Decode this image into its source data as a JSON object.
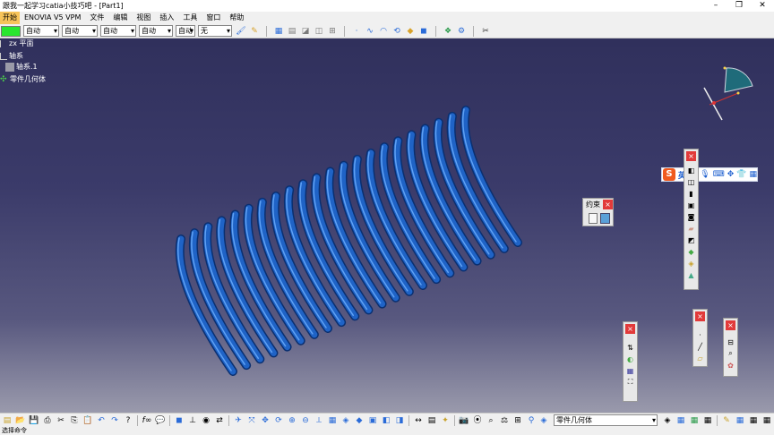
{
  "window": {
    "title": "跟我一起学习catia小技巧吧 - [Part1]",
    "controls": [
      "–",
      "❐",
      "✕"
    ]
  },
  "menubar": {
    "items": [
      {
        "label": "开始",
        "active": true
      },
      {
        "label": "ENOVIA V5 VPM"
      },
      {
        "label": "文件"
      },
      {
        "label": "编辑"
      },
      {
        "label": "视图"
      },
      {
        "label": "插入"
      },
      {
        "label": "工具"
      },
      {
        "label": "窗口"
      },
      {
        "label": "帮助"
      }
    ]
  },
  "properties_toolbar": {
    "color": "#29e62f",
    "combos": [
      {
        "value": "自动",
        "disabled": false
      },
      {
        "value": "自动",
        "disabled": false
      },
      {
        "value": "自动",
        "disabled": false
      },
      {
        "value": "自动",
        "disabled": false
      },
      {
        "value": "自动",
        "disabled": true
      },
      {
        "value": "无",
        "disabled": false
      }
    ],
    "icon_groups": [
      [
        "paintbrush-icon",
        "format-painter-icon"
      ],
      [
        "sketch-icon",
        "grid-icon",
        "plane-icon",
        "view-icon",
        "snap-icon"
      ],
      [
        "point-icon",
        "spline-icon",
        "arc-icon",
        "constraint-icon",
        "surface-icon",
        "body-icon"
      ],
      [
        "part-icon",
        "tools-icon"
      ],
      [
        "measure-icon"
      ]
    ]
  },
  "spec_tree": {
    "nodes": [
      {
        "label": "zx 平面",
        "icon": "plane-icon"
      },
      {
        "label": "轴系",
        "icon": "axis-icon"
      },
      {
        "label": "轴系.1",
        "icon": "axis-system-icon"
      },
      {
        "label": "零件几何体",
        "icon": "part-body-icon"
      }
    ]
  },
  "constraint_toolbar": {
    "title": "约束",
    "close": "×"
  },
  "ime_toolbar": {
    "logo": "S",
    "mode": "英"
  },
  "panel_close": "×",
  "bottom_toolbar": {
    "work_object": "零件几何体"
  },
  "statusbar": {
    "text": "选择命令"
  },
  "colors": {
    "spring": "#1f63c6",
    "viewport_top": "#30305c",
    "close_button": "#e23a3a"
  }
}
